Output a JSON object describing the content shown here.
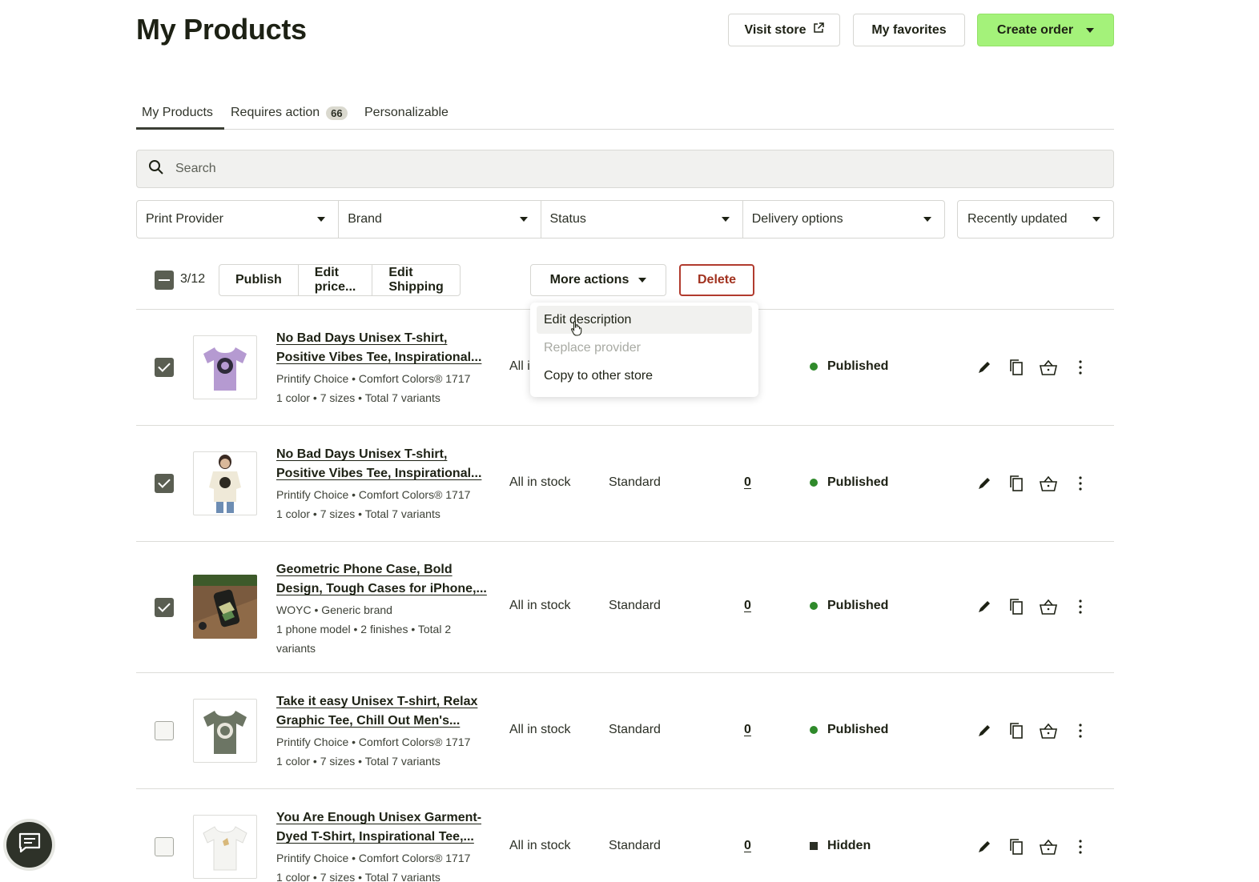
{
  "page": {
    "title": "My Products"
  },
  "header": {
    "visit_store": "Visit store",
    "my_favorites": "My favorites",
    "create_order": "Create order"
  },
  "tabs": [
    {
      "label": "My Products",
      "active": true
    },
    {
      "label": "Requires action",
      "badge": "66"
    },
    {
      "label": "Personalizable"
    }
  ],
  "search": {
    "placeholder": "Search"
  },
  "filters": [
    "Print Provider",
    "Brand",
    "Status",
    "Delivery options"
  ],
  "sort": "Recently updated",
  "bulk": {
    "count": "3/12",
    "publish": "Publish",
    "edit_price": "Edit price...",
    "edit_shipping": "Edit Shipping",
    "more_actions": "More actions",
    "delete": "Delete"
  },
  "more_actions_menu": [
    {
      "label": "Edit description",
      "state": "hover"
    },
    {
      "label": "Replace provider",
      "state": "disabled"
    },
    {
      "label": "Copy to other store",
      "state": "enabled"
    }
  ],
  "products": [
    {
      "checked": true,
      "name_line1": "No Bad Days Unisex T-shirt,",
      "name_line2": "Positive Vibes Tee, Inspirational...",
      "provider": "Printify Choice • Comfort Colors® 1717",
      "variants": "1 color • 7 sizes • Total 7 variants",
      "stock": "All i",
      "shipping": "",
      "orders": "",
      "status": "Published"
    },
    {
      "checked": true,
      "name_line1": "No Bad Days Unisex T-shirt,",
      "name_line2": "Positive Vibes Tee, Inspirational...",
      "provider": "Printify Choice • Comfort Colors® 1717",
      "variants": "1 color • 7 sizes • Total 7 variants",
      "stock": "All in stock",
      "shipping": "Standard",
      "orders": "0",
      "status": "Published"
    },
    {
      "checked": true,
      "name_line1": "Geometric Phone Case, Bold",
      "name_line2": "Design, Tough Cases for iPhone,...",
      "provider": "WOYC • Generic brand",
      "variants": "1 phone model • 2 finishes • Total 2 variants",
      "stock": "All in stock",
      "shipping": "Standard",
      "orders": "0",
      "status": "Published"
    },
    {
      "checked": false,
      "name_line1": "Take it easy Unisex T-shirt, Relax",
      "name_line2": "Graphic Tee, Chill Out Men's...",
      "provider": "Printify Choice • Comfort Colors® 1717",
      "variants": "1 color • 7 sizes • Total 7 variants",
      "stock": "All in stock",
      "shipping": "Standard",
      "orders": "0",
      "status": "Published"
    },
    {
      "checked": false,
      "name_line1": "You Are Enough Unisex Garment-",
      "name_line2": "Dyed T-Shirt, Inspirational Tee,...",
      "provider": "Printify Choice • Comfort Colors® 1717",
      "variants": "1 color • 7 sizes • Total 7 variants",
      "stock": "All in stock",
      "shipping": "Standard",
      "orders": "0",
      "status": "Hidden"
    }
  ],
  "colors": {
    "accent": "#a4f27a",
    "delete": "#b13b2e",
    "published_dot": "#2f8a2b"
  },
  "icons": [
    "external-link-icon",
    "search-icon",
    "pencil-icon",
    "copy-icon",
    "basket-icon",
    "more-vertical-icon",
    "chat-icon"
  ]
}
